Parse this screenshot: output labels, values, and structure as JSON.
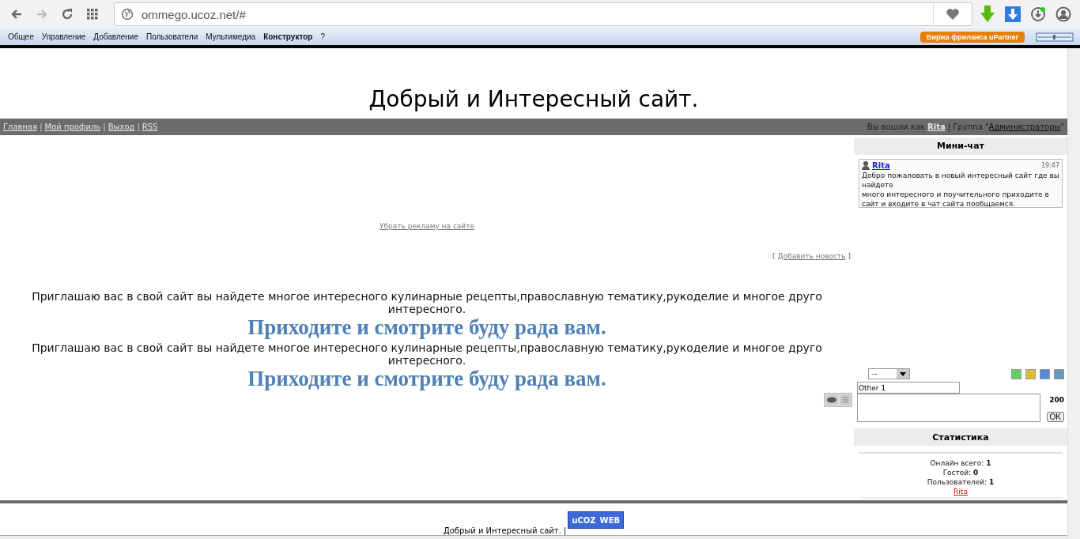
{
  "browser": {
    "url": "ommego.ucoz.net/#"
  },
  "admin_bar": {
    "items": [
      {
        "label": "Общее",
        "selected": false
      },
      {
        "label": "Управление",
        "selected": false
      },
      {
        "label": "Добавление",
        "selected": false
      },
      {
        "label": "Пользователи",
        "selected": false
      },
      {
        "label": "Мультимедиа",
        "selected": false
      },
      {
        "label": "Конструктор",
        "selected": true
      },
      {
        "label": "?",
        "selected": false
      }
    ],
    "promo": "Биржа фриланса uPartner"
  },
  "site_title": "Добрый и Интересный сайт.",
  "nav": {
    "links": [
      "Главная",
      "Мой профиль",
      "Выход",
      "RSS"
    ],
    "separator": "|",
    "login_prefix": "Вы вошли как",
    "user": "Rita",
    "group_prefix": "| Группа \"",
    "group": "Администраторы",
    "group_suffix": "\""
  },
  "main": {
    "ad_link": "Убрать рекламу на сайте",
    "add_news": "Добавить новость",
    "bracket_open": "[",
    "bracket_close": "]",
    "blocks": [
      {
        "text": "Приглашаю вас в свой сайт вы найдете многое интересного кулинарные рецепты,православную тематику,рукоделие и многое друго интересного.",
        "heading": "Приходите и смотрите буду рада вам."
      },
      {
        "text": "Приглашаю вас в свой сайт вы найдете многое интересного кулинарные рецепты,православную тематику,рукоделие и многое друго интересного.",
        "heading": "Приходите и смотрите буду рада вам."
      }
    ]
  },
  "minichat": {
    "title": "Мини-чат",
    "messages": [
      {
        "author": "Rita",
        "time": "19:47",
        "lines": [
          "Добро пожаловать в новый интересный сайт где вы найдете",
          "много интересного и поучительного приходите в сайт и входите в чат сайта пообщаемся."
        ]
      }
    ],
    "select_value": "--",
    "name_value": "Other 1",
    "char_count": "200",
    "ok": "OK"
  },
  "stats": {
    "title": "Статистика",
    "rows": [
      {
        "label": "Онлайн всего:",
        "value": "1"
      },
      {
        "label": "Гостей:",
        "value": "0"
      },
      {
        "label": "Пользователей:",
        "value": "1"
      }
    ],
    "user": "Rita"
  },
  "footer": {
    "text": "Добрый и Интересный сайт. |",
    "logo_left": "uCOZ",
    "logo_right": "WEB"
  }
}
